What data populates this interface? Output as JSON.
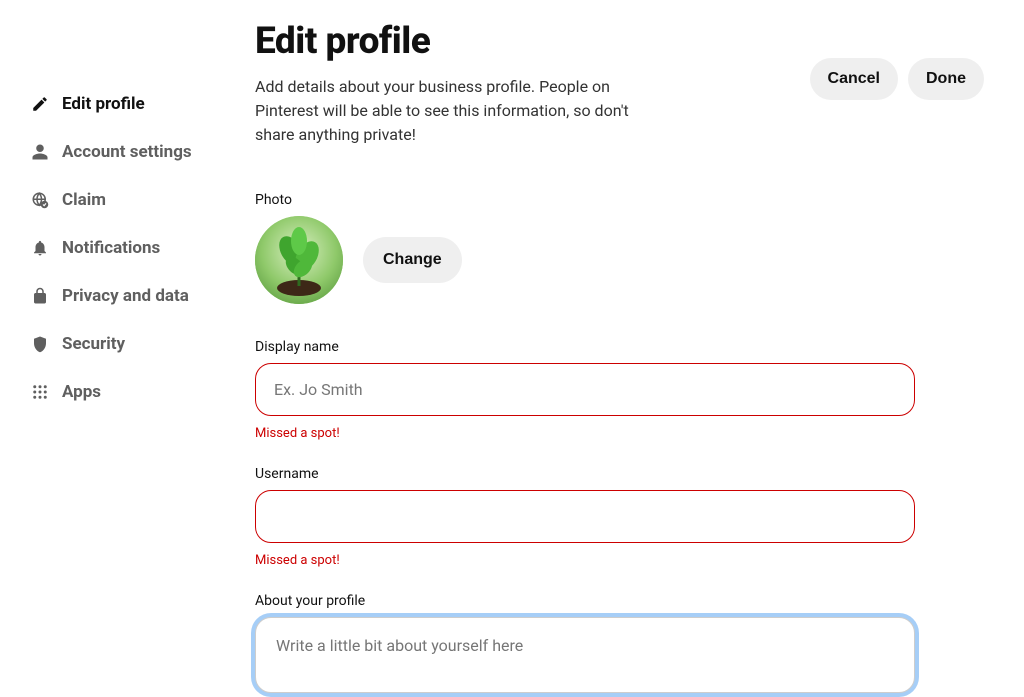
{
  "sidebar": {
    "items": [
      {
        "label": "Edit profile",
        "active": true
      },
      {
        "label": "Account settings",
        "active": false
      },
      {
        "label": "Claim",
        "active": false
      },
      {
        "label": "Notifications",
        "active": false
      },
      {
        "label": "Privacy and data",
        "active": false
      },
      {
        "label": "Security",
        "active": false
      },
      {
        "label": "Apps",
        "active": false
      }
    ]
  },
  "header": {
    "title": "Edit profile",
    "description": "Add details about your business profile. People on Pinterest will be able to see this information, so don't share anything private!",
    "cancel_label": "Cancel",
    "done_label": "Done"
  },
  "form": {
    "photo_label": "Photo",
    "change_label": "Change",
    "display_name": {
      "label": "Display name",
      "placeholder": "Ex. Jo Smith",
      "value": "",
      "error": "Missed a spot!"
    },
    "username": {
      "label": "Username",
      "placeholder": "",
      "value": "",
      "error": "Missed a spot!"
    },
    "about": {
      "label": "About your profile",
      "placeholder": "Write a little bit about yourself here",
      "value": ""
    }
  }
}
